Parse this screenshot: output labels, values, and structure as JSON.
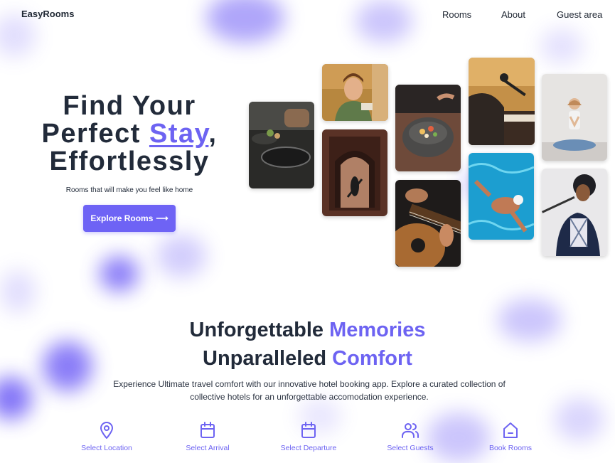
{
  "nav": {
    "brand": "EasyRooms",
    "links": [
      "Rooms",
      "About",
      "Guest area"
    ]
  },
  "hero": {
    "title_line1": "Find Your",
    "title_line2_prefix": "Perfect ",
    "title_line2_accent": "Stay",
    "title_line2_suffix": ",",
    "title_line3": "Effortlessly",
    "subtitle": "Rooms that will make you feel like home",
    "cta_label": "Explore Rooms",
    "cta_arrow": "⟶"
  },
  "gallery": {
    "photos": [
      "cooking",
      "woman-portrait",
      "dancers-doorway",
      "food-bowl",
      "guitar",
      "piano-singer",
      "swimmer",
      "yoga",
      "singer-mic"
    ]
  },
  "section": {
    "line1_prefix": "Unforgettable ",
    "line1_accent": "Memories",
    "line2_prefix": "Unparalleled ",
    "line2_accent": "Comfort",
    "description": "Experience Ultimate travel comfort with our innovative hotel booking app. Explore a curated collection of collective hotels for an unforgettable accomodation experience."
  },
  "features": [
    {
      "label": "Select Location",
      "icon": "map-pin-icon"
    },
    {
      "label": "Select Arrival",
      "icon": "calendar-icon"
    },
    {
      "label": "Select Departure",
      "icon": "calendar-icon"
    },
    {
      "label": "Select Guests",
      "icon": "users-icon"
    },
    {
      "label": "Book Rooms",
      "icon": "home-icon"
    }
  ],
  "colors": {
    "accent": "#6d63f2",
    "text": "#222b3a",
    "background": "#ffffff"
  }
}
